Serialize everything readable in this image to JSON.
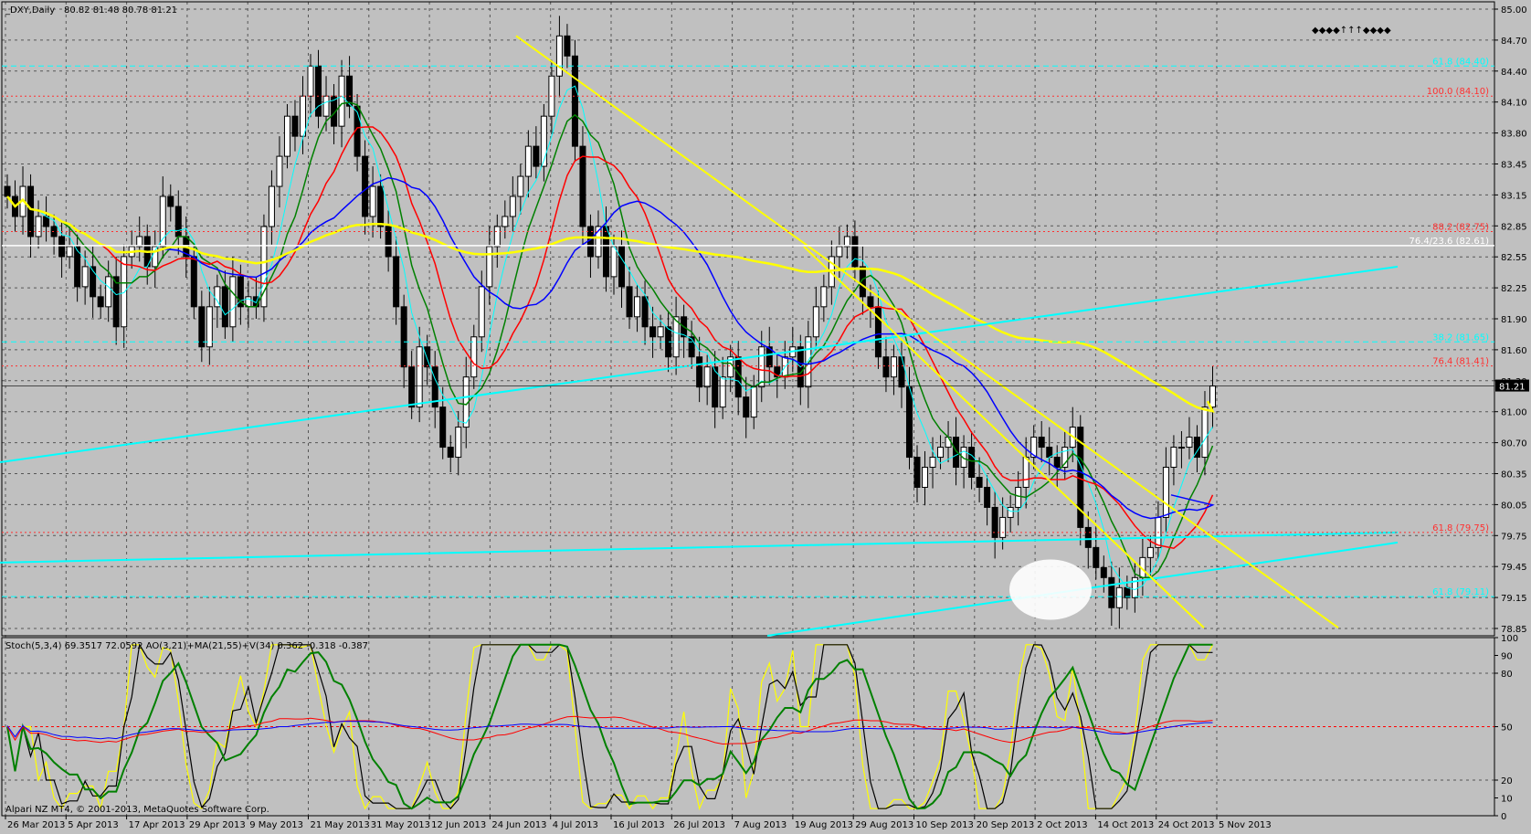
{
  "chart_data": [
    {
      "type": "candlestick",
      "title": "_DXY,Daily",
      "ohlc_header": "80.82 81.48 80.78 81.21",
      "ylim": [
        78.72,
        85.04
      ],
      "yticks": [
        "85.00",
        "84.70",
        "84.40",
        "84.10",
        "83.80",
        "83.45",
        "83.15",
        "82.85",
        "82.55",
        "82.25",
        "81.90",
        "81.60",
        "81.30",
        "81.00",
        "80.70",
        "80.35",
        "80.05",
        "79.75",
        "79.45",
        "79.15",
        "78.85"
      ],
      "current_price": "81.21",
      "xticks": [
        "26 Mar 2013",
        "5 Apr 2013",
        "17 Apr 2013",
        "29 Apr 2013",
        "9 May 2013",
        "21 May 2013",
        "31 May 2013",
        "12 Jun 2013",
        "24 Jun 2013",
        "4 Jul 2013",
        "16 Jul 2013",
        "26 Jul 2013",
        "7 Aug 2013",
        "19 Aug 2013",
        "29 Aug 2013",
        "10 Sep 2013",
        "20 Sep 2013",
        "2 Oct 2013",
        "14 Oct 2013",
        "24 Oct 2013",
        "5 Nov 2013"
      ],
      "fib_labels": [
        {
          "text": "100.0 (84.10)",
          "value": 84.1,
          "color": "#ff3030"
        },
        {
          "text": "88.2 (82.75)",
          "value": 82.75,
          "color": "#ff3030"
        },
        {
          "text": "76.4 (81.41)",
          "value": 81.41,
          "color": "#ff3030"
        },
        {
          "text": "61.8 (79.75)",
          "value": 79.75,
          "color": "#ff3030"
        }
      ],
      "white_label": {
        "text": "76.4/23.6 (82.61)",
        "value": 82.61
      },
      "cyan_labels": [
        {
          "text": "61.8 (84.40)",
          "value": 84.4
        },
        {
          "text": "38.2 (81.65)",
          "value": 81.65
        },
        {
          "text": "61.8 (79.11)",
          "value": 79.11
        }
      ],
      "closes": [
        83.1,
        82.9,
        83.2,
        82.7,
        82.9,
        82.8,
        82.7,
        82.5,
        82.6,
        82.2,
        82.4,
        82.1,
        82.0,
        82.3,
        81.8,
        82.5,
        82.6,
        82.7,
        82.4,
        82.6,
        83.1,
        83.0,
        82.7,
        82.5,
        82.0,
        81.6,
        82.0,
        82.2,
        81.8,
        82.3,
        82.0,
        82.1,
        82.0,
        82.8,
        83.2,
        83.5,
        83.9,
        83.7,
        84.1,
        84.4,
        83.9,
        84.1,
        83.8,
        84.3,
        84.0,
        83.5,
        82.9,
        83.2,
        82.8,
        82.5,
        82.0,
        81.4,
        81.0,
        81.6,
        81.4,
        81.0,
        80.6,
        80.5,
        80.8,
        81.3,
        81.7,
        82.2,
        82.6,
        82.8,
        82.9,
        83.1,
        83.3,
        83.6,
        83.4,
        83.9,
        84.3,
        84.7,
        84.5,
        83.6,
        82.8,
        82.5,
        82.8,
        82.3,
        82.6,
        82.2,
        81.9,
        82.1,
        81.8,
        81.7,
        81.8,
        81.5,
        81.9,
        81.7,
        81.5,
        81.2,
        81.4,
        81.0,
        81.3,
        81.5,
        81.1,
        80.9,
        81.2,
        81.6,
        81.4,
        81.3,
        81.5,
        81.6,
        81.2,
        81.7,
        82.0,
        82.2,
        82.5,
        82.6,
        82.7,
        82.4,
        82.1,
        82.0,
        81.5,
        81.3,
        81.5,
        81.2,
        80.5,
        80.2,
        80.4,
        80.5,
        80.6,
        80.7,
        80.4,
        80.6,
        80.3,
        80.2,
        80.0,
        79.7,
        79.9,
        80.0,
        80.2,
        80.5,
        80.7,
        80.6,
        80.5,
        80.4,
        80.6,
        80.8,
        79.8,
        79.6,
        79.4,
        79.3,
        79.0,
        79.2,
        79.1,
        79.3,
        79.5,
        79.6,
        79.9,
        80.4,
        80.6,
        80.6,
        80.7,
        80.5,
        81.0,
        81.21
      ]
    },
    {
      "type": "line",
      "title": "Stoch(5,3,4) 69.3517 72.0592  AO(3,21)+MA(21,55)+V(34) 0.362 -0.318 -0.387",
      "ylim": [
        0,
        100
      ],
      "yticks": [
        "100",
        "90",
        "80",
        "50",
        "20",
        "10",
        "0"
      ],
      "copyright": "Alpari NZ MT4, © 2001-2013, MetaQuotes Software Corp."
    }
  ],
  "signals": {
    "label": "◆◆◆◆↑↑↑◆◆◆◆"
  }
}
